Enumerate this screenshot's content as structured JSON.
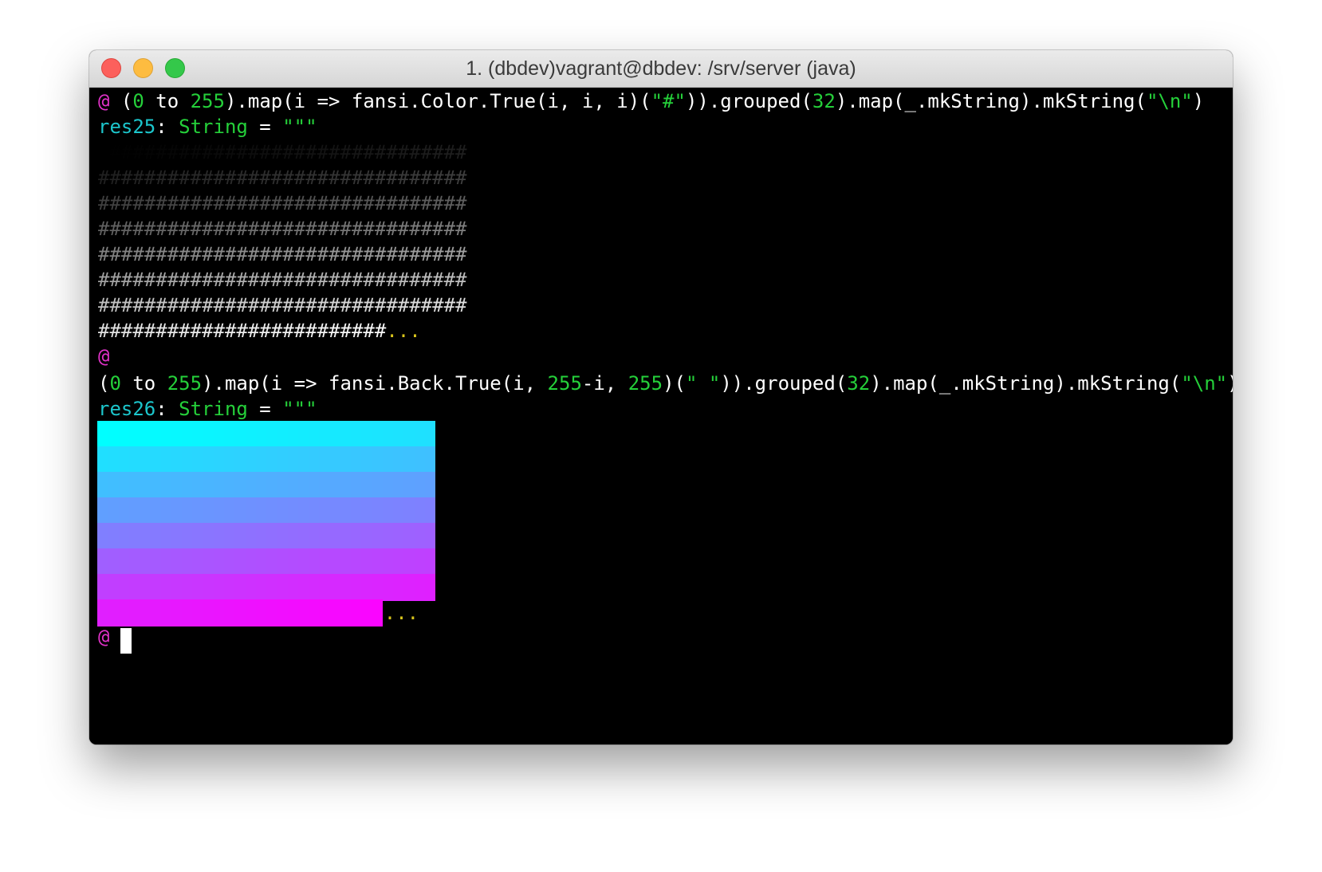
{
  "window": {
    "title": "1. (dbdev)vagrant@dbdev: /srv/server (java)"
  },
  "colors": {
    "prompt": "#e232c9",
    "number": "#25d03a",
    "result": "#1cc6cc",
    "string_type": "#25d03a",
    "ellipsis": "#d8c41c",
    "background": "#000000"
  },
  "session": {
    "prompt": "@",
    "cmd1": {
      "p1": "(",
      "n1": "0",
      "p2": " to ",
      "n2": "255",
      "p3": ").map(i => fansi.Color.True(i, i, i)(",
      "s1": "\"#\"",
      "p4": ")).grouped(",
      "n3": "32",
      "p5": ").map(_.mkString).mkString(",
      "s2": "\"\\n\"",
      "p6": ")"
    },
    "res25": {
      "name": "res25",
      "colon": ": ",
      "type": "String",
      "eq": " = ",
      "quote": "\"\"\""
    },
    "hash_rows": [
      "################################",
      "################################",
      "################################",
      "################################",
      "################################",
      "################################",
      "################################",
      "#########################"
    ],
    "ellipsis": "...",
    "cmd2": {
      "p1": "(",
      "n1": "0",
      "p2": " to ",
      "n2": "255",
      "p3": ").map(i => fansi.Back.True(i, ",
      "n3": "255",
      "p4": "-i, ",
      "n4": "255",
      "p5": ")(",
      "s1": "\" \"",
      "p6": ")).grouped(",
      "n5": "32",
      "p7": ").map(_.mkString).mkString(",
      "s2": "\"\\n\"",
      "p8": ")"
    },
    "res26": {
      "name": "res26",
      "colon": ": ",
      "type": "String",
      "eq": " = ",
      "quote": "\"\"\""
    },
    "color_rows": 8,
    "cells_per_row": 32,
    "last_row_cells": 27
  }
}
